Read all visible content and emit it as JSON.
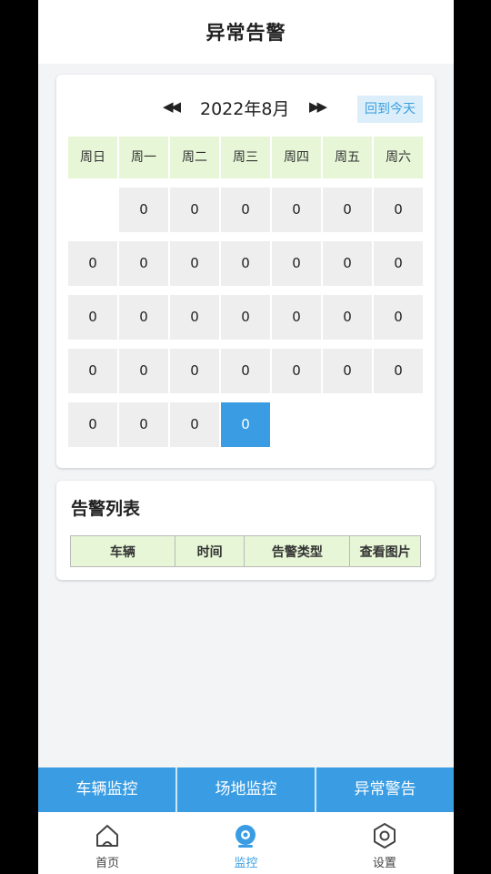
{
  "header": {
    "title": "异常告警"
  },
  "calendar": {
    "prev_icon": "◀◀",
    "month_label": "2022年8月",
    "next_icon": "▶▶",
    "today_label": "回到今天",
    "weekdays": [
      "周日",
      "周一",
      "周二",
      "周三",
      "周四",
      "周五",
      "周六"
    ],
    "days": [
      "",
      "0",
      "0",
      "0",
      "0",
      "0",
      "0",
      "0",
      "0",
      "0",
      "0",
      "0",
      "0",
      "0",
      "0",
      "0",
      "0",
      "0",
      "0",
      "0",
      "0",
      "0",
      "0",
      "0",
      "0",
      "0",
      "0",
      "0",
      "0",
      "0",
      "0",
      "0"
    ],
    "today_index": 31
  },
  "alarm_list": {
    "title": "告警列表",
    "columns": [
      "车辆",
      "时间",
      "告警类型",
      "查看图片"
    ]
  },
  "bottom_tabs": [
    "车辆监控",
    "场地监控",
    "异常警告"
  ],
  "nav": [
    {
      "label": "首页",
      "icon": "home-icon"
    },
    {
      "label": "监控",
      "icon": "camera-icon"
    },
    {
      "label": "设置",
      "icon": "settings-hexagon-icon"
    }
  ],
  "colors": {
    "accent": "#3a9de3",
    "header_green": "#e6f6d6",
    "day_bg": "#eeeeee"
  }
}
